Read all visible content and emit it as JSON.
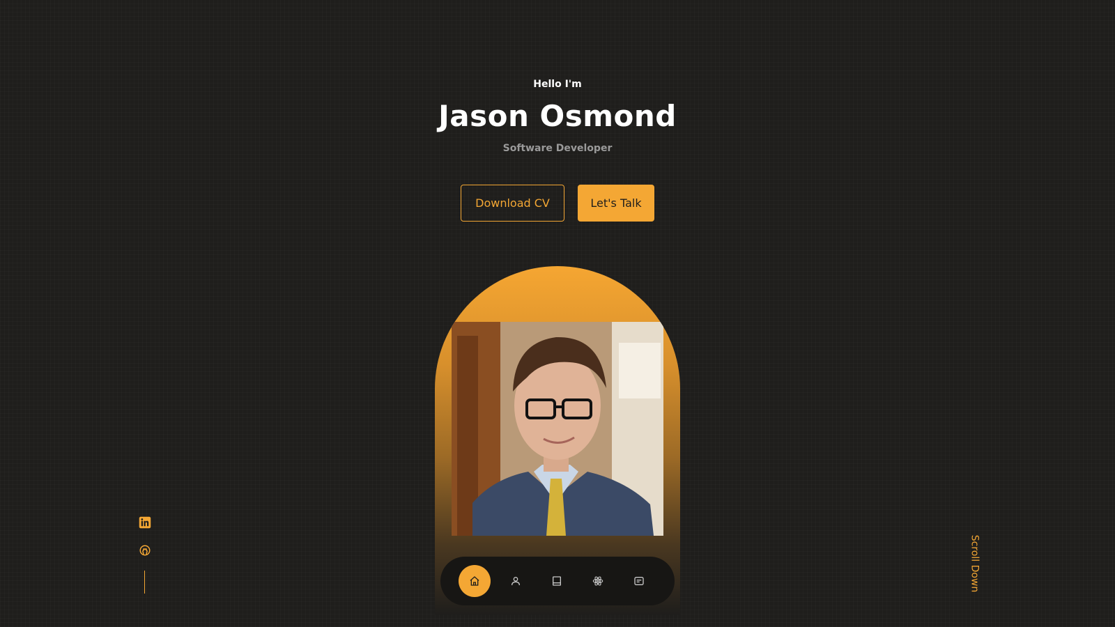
{
  "hero": {
    "greeting": "Hello I'm",
    "name": "Jason Osmond",
    "role": "Software Developer"
  },
  "actions": {
    "download_cv": "Download CV",
    "lets_talk": "Let's Talk"
  },
  "nav": {
    "items": [
      {
        "icon": "home-icon",
        "active": true
      },
      {
        "icon": "user-icon",
        "active": false
      },
      {
        "icon": "book-icon",
        "active": false
      },
      {
        "icon": "atom-icon",
        "active": false
      },
      {
        "icon": "message-icon",
        "active": false
      }
    ]
  },
  "socials": {
    "items": [
      {
        "icon": "linkedin-icon"
      },
      {
        "icon": "github-icon"
      }
    ]
  },
  "scroll": {
    "label": "Scroll Down"
  },
  "colors": {
    "accent": "#f4a734",
    "background": "#1f1e1c",
    "dock": "#171614"
  }
}
